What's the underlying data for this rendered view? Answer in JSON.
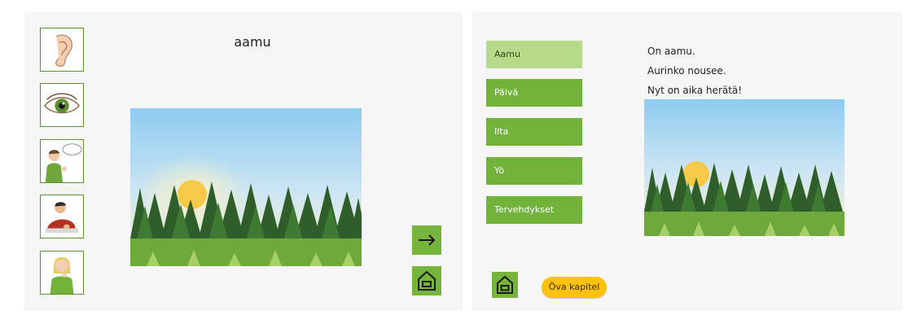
{
  "left": {
    "word": "aamu",
    "sense_cards": [
      {
        "icon": "ear-icon"
      },
      {
        "icon": "eye-icon"
      },
      {
        "icon": "speaking-person-icon"
      },
      {
        "icon": "writing-person-icon"
      },
      {
        "icon": "thinking-person-icon"
      }
    ],
    "scene": "sunrise-forest-image",
    "next_icon": "arrow-right-icon",
    "home_icon": "home-icon"
  },
  "right": {
    "menu": [
      {
        "label": "Aamu",
        "active": true
      },
      {
        "label": "Päivä",
        "active": false
      },
      {
        "label": "Ilta",
        "active": false
      },
      {
        "label": "Yö",
        "active": false
      },
      {
        "label": "Tervehdykset",
        "active": false
      }
    ],
    "story": [
      "On aamu.",
      "Aurinko nousee.",
      "Nyt on aika herätä!"
    ],
    "scene": "sunrise-forest-image",
    "home_icon": "home-icon",
    "practice_button": "Öva kapitel"
  },
  "colors": {
    "green": "#75b53e",
    "green_active": "#b6d98a",
    "yellow": "#ffc20e",
    "panel": "#f6f6f6"
  }
}
